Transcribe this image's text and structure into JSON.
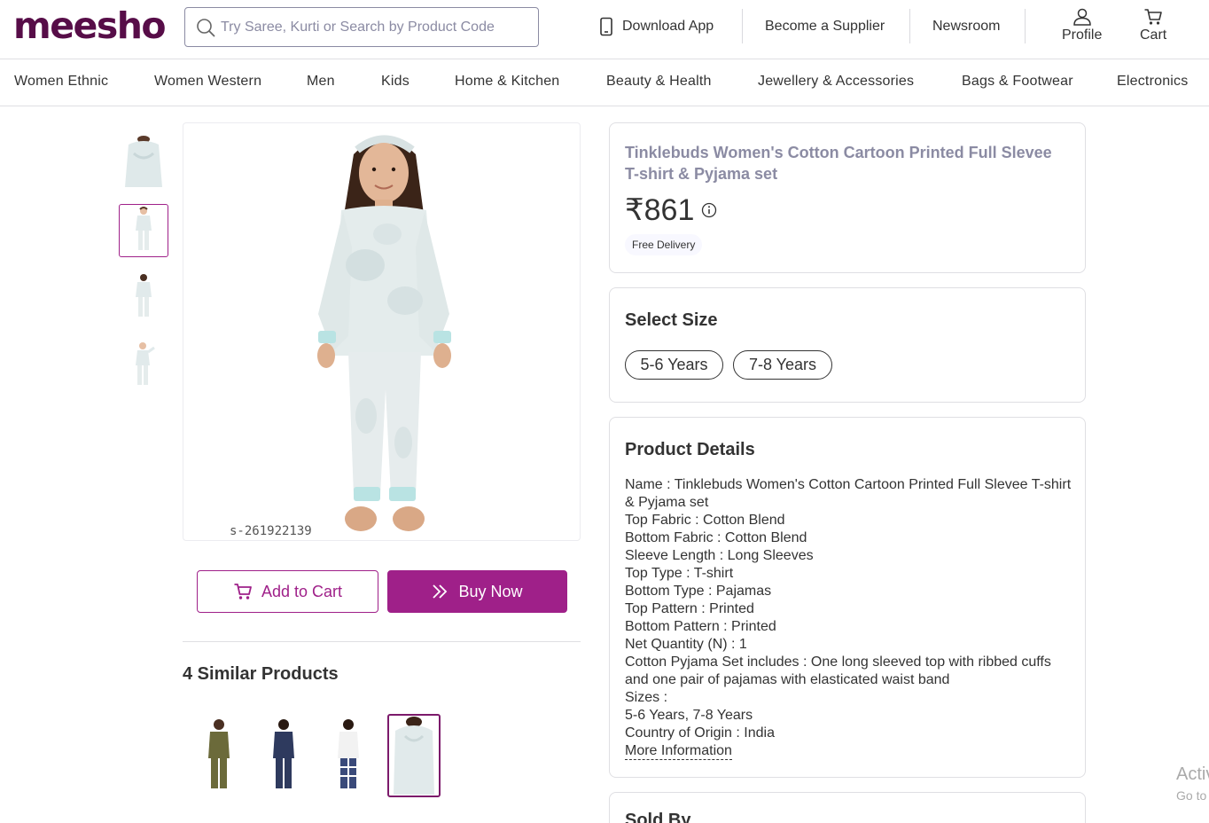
{
  "brand": {
    "logo": "meesho",
    "color": "#570d48",
    "accent": "#9f2089"
  },
  "search": {
    "placeholder": "Try Saree, Kurti or Search by Product Code"
  },
  "header": {
    "download_app": "Download App",
    "become_supplier": "Become a Supplier",
    "newsroom": "Newsroom",
    "profile": "Profile",
    "cart": "Cart"
  },
  "categories": [
    "Women Ethnic",
    "Women Western",
    "Men",
    "Kids",
    "Home & Kitchen",
    "Beauty & Health",
    "Jewellery & Accessories",
    "Bags & Footwear",
    "Electronics"
  ],
  "product": {
    "title": "Tinklebuds Women's Cotton Cartoon Printed Full Slevee T-shirt & Pyjama set",
    "price": "₹861",
    "delivery": "Free Delivery",
    "image_code": "s-261922139",
    "add_to_cart": "Add to Cart",
    "buy_now": "Buy Now"
  },
  "sizes": {
    "title": "Select Size",
    "options": [
      "5-6 Years",
      "7-8 Years"
    ]
  },
  "details": {
    "title": "Product Details",
    "rows": [
      "Name : Tinklebuds Women's Cotton Cartoon Printed Full Slevee T-shirt & Pyjama set",
      "Top Fabric : Cotton Blend",
      "Bottom Fabric : Cotton Blend",
      "Sleeve Length : Long Sleeves",
      "Top Type : T-shirt",
      "Bottom Type : Pajamas",
      "Top Pattern : Printed",
      "Bottom Pattern : Printed",
      "Net Quantity (N) : 1",
      "Cotton Pyjama Set includes : One long sleeved top with ribbed cuffs and one pair of pajamas with elasticated waist band",
      "Sizes :",
      "5-6 Years, 7-8 Years",
      "Country of Origin : India"
    ],
    "more": "More Information"
  },
  "similar": {
    "title": "4 Similar Products"
  },
  "sold_by": {
    "title": "Sold By"
  },
  "windows_watermark": {
    "line1": "Activ",
    "line2": "Go to"
  },
  "icons": [
    "search-icon",
    "phone-icon",
    "user-icon",
    "cart-icon",
    "info-icon",
    "double-chevron-icon"
  ]
}
